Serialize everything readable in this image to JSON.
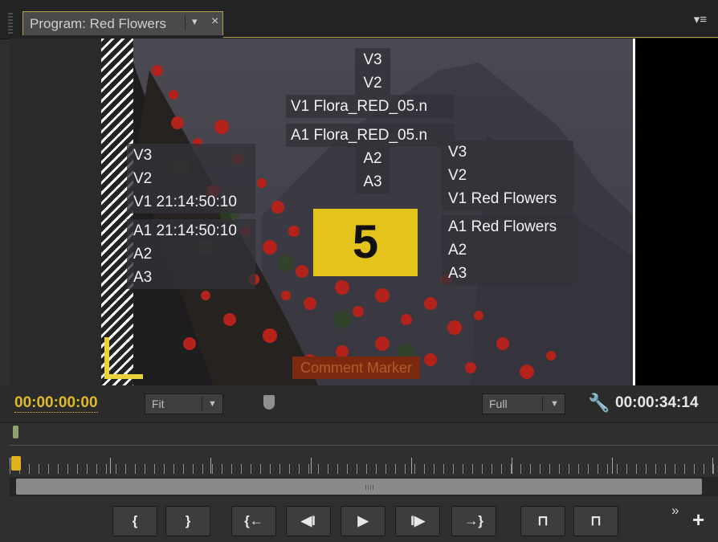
{
  "tab": {
    "title": "Program: Red Flowers",
    "menu_glyph": "▾",
    "close_glyph": "×",
    "panel_menu_glyph": "▾≡"
  },
  "overlays": {
    "source_tracks": [
      "V3",
      "V2",
      "V1 Flora_RED_05.n",
      "A1 Flora_RED_05.n",
      "A2",
      "A3"
    ],
    "timecode_tracks_video": [
      "V3",
      "V2",
      "V1 21:14:50:10"
    ],
    "timecode_tracks_audio": [
      "A1 21:14:50:10",
      "A2",
      "A3"
    ],
    "sequence_tracks_video": [
      "V3",
      "V2",
      "V1 Red Flowers"
    ],
    "sequence_tracks_audio": [
      "A1 Red Flowers",
      "A2",
      "A3"
    ],
    "countdown_number": "5",
    "comment_marker": "Comment Marker"
  },
  "controls": {
    "playhead_timecode": "00:00:00:00",
    "zoom": {
      "selected": "Fit"
    },
    "resolution": {
      "selected": "Full"
    },
    "duration_timecode": "00:00:34:14"
  },
  "transport": {
    "buttons": [
      {
        "name": "mark-in-button",
        "glyph": "{"
      },
      {
        "name": "mark-out-button",
        "glyph": "}"
      },
      {
        "name": "go-to-in-button",
        "glyph": "{←"
      },
      {
        "name": "step-back-button",
        "glyph": "◀I"
      },
      {
        "name": "play-button",
        "glyph": "▶"
      },
      {
        "name": "step-forward-button",
        "glyph": "I▶"
      },
      {
        "name": "go-to-out-button",
        "glyph": "→}"
      },
      {
        "name": "lift-button",
        "glyph": "⊓"
      },
      {
        "name": "extract-button",
        "glyph": "⊓"
      }
    ],
    "more_glyph": "»",
    "add_glyph": "+"
  },
  "colors": {
    "accent_timecode": "#e0b82c",
    "countdown_yellow": "#e4c41c",
    "comment_marker_bg": "#7b2a10"
  }
}
